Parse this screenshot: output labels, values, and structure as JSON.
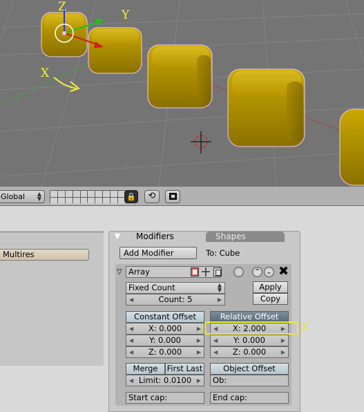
{
  "viewport": {
    "axis_labels": {
      "z": "Z",
      "y": "Y",
      "x": "X"
    },
    "object_color": "#bfa000",
    "highlight_color": "#f2ee3c"
  },
  "header": {
    "transform_space": "Global",
    "icons": [
      "layer-grid-icon",
      "lock-icon",
      "link-icon",
      "render-icon"
    ]
  },
  "left_panel": {
    "multires_label": "Multires"
  },
  "modifier_panel": {
    "tabs": [
      "Modifiers",
      "Shapes"
    ],
    "add_modifier_label": "Add Modifier",
    "target_label": "To: Cube",
    "array": {
      "name": "Array",
      "fit_type": "Fixed Count",
      "count_label": "Count: 5",
      "apply_label": "Apply",
      "copy_label": "Copy",
      "constant_offset": {
        "label": "Constant Offset",
        "x": "X: 0.000",
        "y": "Y: 0.000",
        "z": "Z: 0.000"
      },
      "relative_offset": {
        "label": "Relative Offset",
        "x": "X: 2.000",
        "y": "Y: 0.000",
        "z": "Z: 0.000"
      },
      "merge_label": "Merge",
      "first_last_label": "First Last",
      "limit_label": "Limit: 0.0100",
      "object_offset_label": "Object Offset",
      "ob_label": "Ob:",
      "start_cap_label": "Start cap:",
      "end_cap_label": "End cap:"
    }
  },
  "annotation": {
    "x_label": "X",
    "color": "#e8e826"
  }
}
